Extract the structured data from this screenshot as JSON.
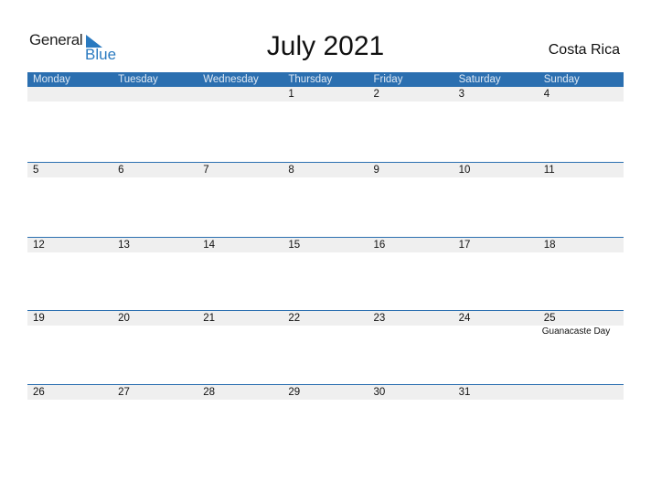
{
  "logo": {
    "general": "General",
    "blue": "Blue",
    "icon": "triangle-flag-icon"
  },
  "title": "July 2021",
  "country": "Costa Rica",
  "colors": {
    "accent": "#2b6fb0",
    "strip": "#efefef",
    "logo_blue": "#2a7ac0"
  },
  "weekdays": [
    "Monday",
    "Tuesday",
    "Wednesday",
    "Thursday",
    "Friday",
    "Saturday",
    "Sunday"
  ],
  "weeks": [
    {
      "days": [
        "",
        "",
        "",
        "1",
        "2",
        "3",
        "4"
      ],
      "events": [
        "",
        "",
        "",
        "",
        "",
        "",
        ""
      ]
    },
    {
      "days": [
        "5",
        "6",
        "7",
        "8",
        "9",
        "10",
        "11"
      ],
      "events": [
        "",
        "",
        "",
        "",
        "",
        "",
        ""
      ]
    },
    {
      "days": [
        "12",
        "13",
        "14",
        "15",
        "16",
        "17",
        "18"
      ],
      "events": [
        "",
        "",
        "",
        "",
        "",
        "",
        ""
      ]
    },
    {
      "days": [
        "19",
        "20",
        "21",
        "22",
        "23",
        "24",
        "25"
      ],
      "events": [
        "",
        "",
        "",
        "",
        "",
        "",
        "Guanacaste Day"
      ]
    },
    {
      "days": [
        "26",
        "27",
        "28",
        "29",
        "30",
        "31",
        ""
      ],
      "events": [
        "",
        "",
        "",
        "",
        "",
        "",
        ""
      ]
    }
  ]
}
